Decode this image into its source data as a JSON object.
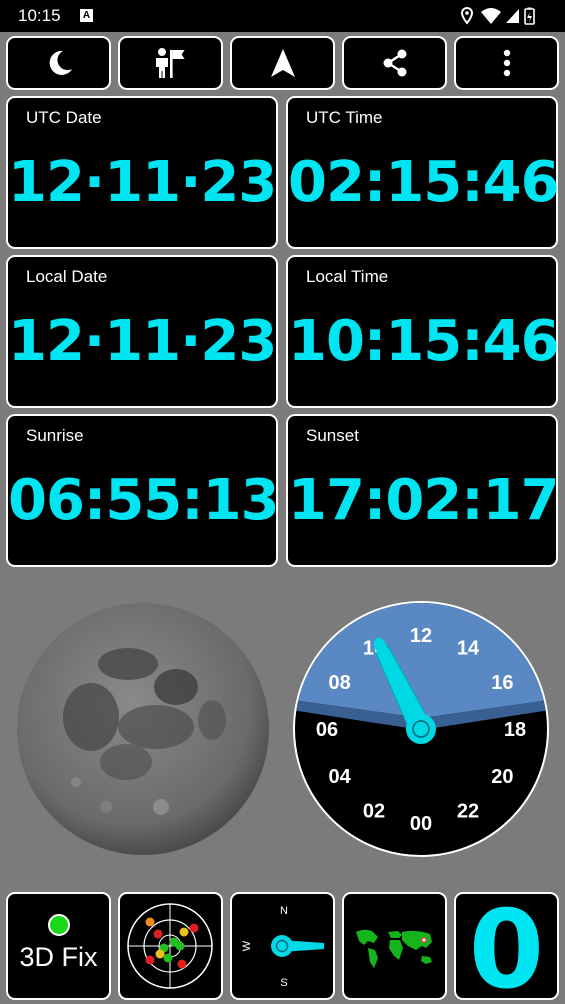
{
  "status_bar": {
    "time": "10:15",
    "app_icon_letter": "A"
  },
  "toolbar": {
    "items": [
      {
        "icon": "moon-icon"
      },
      {
        "icon": "person-flag-icon"
      },
      {
        "icon": "navigation-arrow-icon"
      },
      {
        "icon": "share-icon"
      },
      {
        "icon": "more-vert-icon"
      }
    ]
  },
  "cards": {
    "utc_date": {
      "label": "UTC Date",
      "value": "12·11·23"
    },
    "utc_time": {
      "label": "UTC Time",
      "value": "02:15:46"
    },
    "local_date": {
      "label": "Local Date",
      "value": "12·11·23"
    },
    "local_time": {
      "label": "Local Time",
      "value": "10:15:46"
    },
    "sunrise": {
      "label": "Sunrise",
      "value": "06:55:13"
    },
    "sunset": {
      "label": "Sunset",
      "value": "17:02:17"
    }
  },
  "clock24": {
    "hour_labels": [
      "00",
      "02",
      "04",
      "06",
      "08",
      "10",
      "12",
      "14",
      "16",
      "18",
      "20",
      "22"
    ],
    "current_hour": 10.26
  },
  "bottom": {
    "fix_label": "3D Fix",
    "compass": {
      "n": "N",
      "s": "S",
      "w": "W"
    },
    "satellite_count": "0"
  },
  "colors": {
    "accent": "#00e5f2",
    "background": "#7b7b7b",
    "fix_green": "#18d818",
    "day_sky": "#5a88c2"
  }
}
